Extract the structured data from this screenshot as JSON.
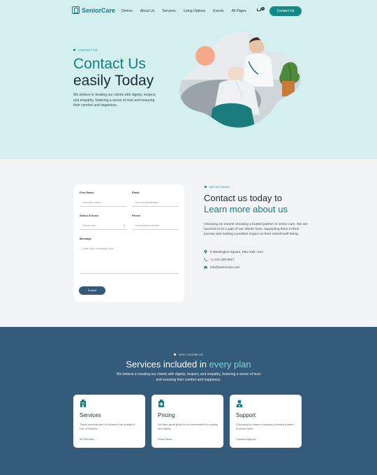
{
  "brand": {
    "name": "SeniorCare"
  },
  "nav": {
    "items": [
      "Demos",
      "About Us",
      "Services",
      "Living Options",
      "Events",
      "All Pages"
    ],
    "cart_count": "0",
    "cta": "Contact Us"
  },
  "hero": {
    "eyebrow": "CONTACT US",
    "title_line1": "Contact Us",
    "title_line2": "easily Today",
    "description": "We believe in treating our clients with dignity, respect, and empathy, fostering a sense of trust and ensuring their comfort and happiness."
  },
  "form": {
    "first_name_label": "First Name",
    "first_name_placeholder": "Your first name",
    "email_label": "Email",
    "email_placeholder": "Your email address",
    "service_label": "Select Service",
    "service_value": "Select one...",
    "phone_label": "Phone",
    "phone_placeholder": "Your phone number",
    "message_label": "Message",
    "message_placeholder": "Enter your message here",
    "submit": "Submit"
  },
  "contact_info": {
    "eyebrow": "GET IN TOUCH",
    "title_line1": "Contact us today to",
    "title_line2": "Learn more about us",
    "description": "Choosing Us means choosing a trusted partner in senior care. We are honored to be a part of our clients' lives, supporting them in their journey and making a positive impact on their overall well-being.",
    "address": "9 Washington Square, New York, USA",
    "phone": "+1 212-405-9617",
    "email": "info@seniorcare.com"
  },
  "services": {
    "eyebrow": "WHY CHOOSE US",
    "title_main": "Services included in",
    "title_highlight": "every plan",
    "description": "We believe in treating our clients with dignity, respect, and empathy, fostering a sense of trust and ensuring their comfort and happiness.",
    "cards": [
      {
        "title": "Services",
        "desc": "These services aim to enhance the quality of Life of Seniors",
        "link": "All Services",
        "icon": "building-icon"
      },
      {
        "title": "Pricing",
        "desc": "We take great pride in our commitment to quality and safety",
        "link": "Show More",
        "icon": "medical-kit-icon"
      },
      {
        "title": "Support",
        "desc": "Choosing us means choosing a trusted partner in senior care.",
        "link": "Contact support",
        "icon": "caregiver-icon"
      }
    ]
  },
  "colors": {
    "teal": "#13807f",
    "hero_bg": "#d4eff0",
    "navy": "#345b7a",
    "peach": "#f5a98a"
  }
}
